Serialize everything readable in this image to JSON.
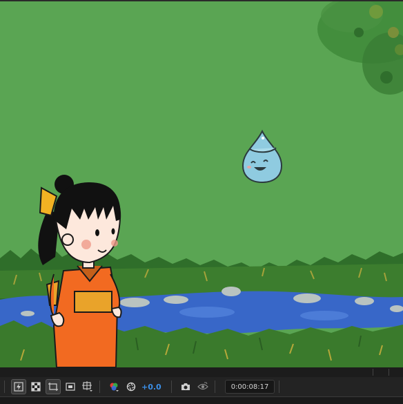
{
  "viewer": {
    "background_color": "#5aa553",
    "characters": [
      "girl-in-kimono",
      "water-droplet-mascot"
    ]
  },
  "toolbar": {
    "buttons": [
      {
        "name": "fast-previews-icon",
        "active": true
      },
      {
        "name": "transparency-grid-icon",
        "active": false
      },
      {
        "name": "region-of-interest-icon",
        "active": true
      },
      {
        "name": "toggle-mask-visibility-icon",
        "active": false
      },
      {
        "name": "guides-grid-icon",
        "active": false
      }
    ],
    "exposure_value": "+0.0",
    "timecode": "0:00:08:17",
    "accent_color": "#3b8fe8"
  }
}
